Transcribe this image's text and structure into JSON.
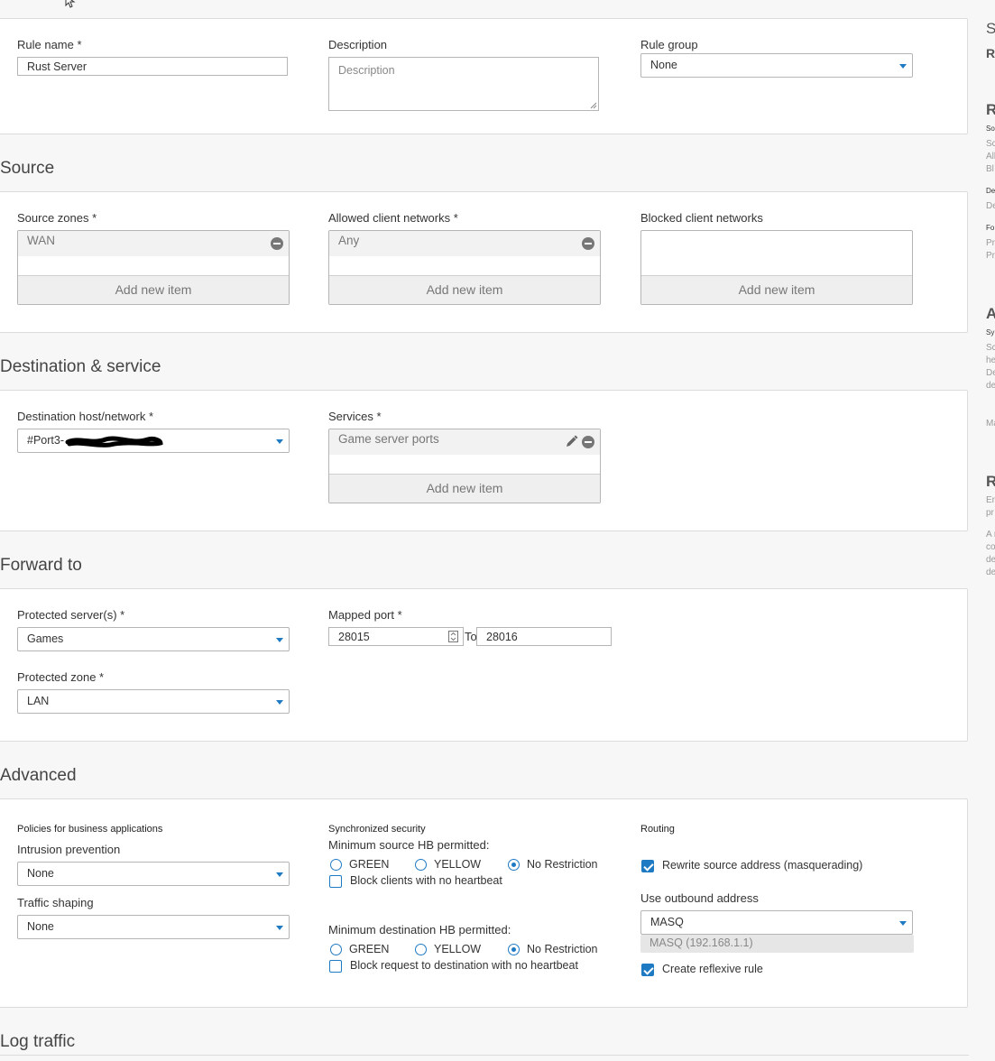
{
  "general": {
    "rule_name_label": "Rule name *",
    "rule_name_value": "Rust Server",
    "description_label": "Description",
    "description_placeholder": "Description",
    "rule_group_label": "Rule group",
    "rule_group_value": "None"
  },
  "source": {
    "title": "Source",
    "zones_label": "Source zones *",
    "zones_items": [
      "WAN"
    ],
    "allowed_label": "Allowed client networks *",
    "allowed_items": [
      "Any"
    ],
    "blocked_label": "Blocked client networks",
    "add_label": "Add new item"
  },
  "destination": {
    "title": "Destination & service",
    "host_label": "Destination host/network *",
    "host_value": "#Port3-",
    "services_label": "Services *",
    "services_items": [
      "Game server ports"
    ],
    "add_label": "Add new item"
  },
  "forward": {
    "title": "Forward to",
    "protected_servers_label": "Protected server(s) *",
    "protected_servers_value": "Games",
    "mapped_port_label": "Mapped port *",
    "mapped_port_from": "28015",
    "to_label": "To",
    "mapped_port_to": "28016",
    "protected_zone_label": "Protected zone *",
    "protected_zone_value": "LAN"
  },
  "advanced": {
    "title": "Advanced",
    "policies_heading": "Policies for business applications",
    "ips_label": "Intrusion prevention",
    "ips_value": "None",
    "shaping_label": "Traffic shaping",
    "shaping_value": "None",
    "sync_heading": "Synchronized security",
    "min_source_label": "Minimum source HB permitted:",
    "min_dest_label": "Minimum destination HB permitted:",
    "radio_green": "GREEN",
    "radio_yellow": "YELLOW",
    "radio_norestrict": "No Restriction",
    "source_selected": "No Restriction",
    "dest_selected": "No Restriction",
    "block_clients_label": "Block clients with no heartbeat",
    "block_clients_checked": false,
    "block_dest_label": "Block request to destination with no heartbeat",
    "block_dest_checked": false,
    "routing_heading": "Routing",
    "rewrite_label": "Rewrite source address (masquerading)",
    "rewrite_checked": true,
    "outbound_label": "Use outbound address",
    "outbound_value": "MASQ",
    "outbound_hint": "MASQ (192.168.1.1)",
    "reflexive_label": "Create reflexive rule",
    "reflexive_checked": true
  },
  "log": {
    "title": "Log traffic"
  },
  "help_sidebar": {
    "lines": [
      "S",
      "R",
      "R",
      "So",
      "Sc",
      "All",
      "Bl",
      "De",
      "De",
      "Fo",
      "Pr",
      "Pr",
      "A",
      "Sy",
      "Sc",
      "he",
      "De",
      "de",
      "Ma",
      "R",
      "Er",
      "pr",
      "A r",
      "co",
      "de",
      "de"
    ]
  },
  "colors": {
    "accent": "#1f7ac4",
    "panel_border": "#dcdcdc",
    "page_bg": "#f7f7f7"
  }
}
